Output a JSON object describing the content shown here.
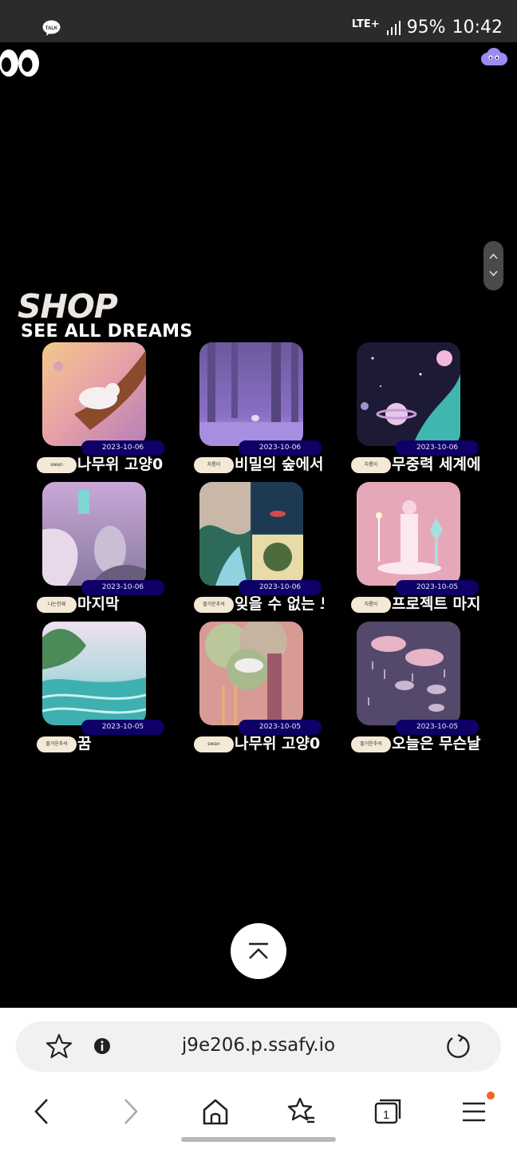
{
  "status_bar": {
    "talk_label": "TALK",
    "network": "LTE+",
    "battery": "95%",
    "time": "10:42",
    "icons": [
      "kakaotalk-icon",
      "signal-icon"
    ]
  },
  "header": {
    "logo": "eyes-logo-icon",
    "menu": "cloud-character-icon"
  },
  "shop": {
    "title": "SHOP",
    "subtitle": "SEE ALL DREAMS"
  },
  "cards": [
    {
      "date": "2023-10-06",
      "author": "swan",
      "title": "나무위 고양0"
    },
    {
      "date": "2023-10-06",
      "author": "차룡이",
      "title": "비밀의 숲에서"
    },
    {
      "date": "2023-10-06",
      "author": "차룡이",
      "title": "무중력 세계에서"
    },
    {
      "date": "2023-10-06",
      "author": "나는천재",
      "title": "마지막"
    },
    {
      "date": "2023-10-06",
      "author": "즐거운추석",
      "title": "잊을 수 없는 드"
    },
    {
      "date": "2023-10-05",
      "author": "차룡이",
      "title": "프로젝트 마지막"
    },
    {
      "date": "2023-10-05",
      "author": "즐거운추석",
      "title": "꿈"
    },
    {
      "date": "2023-10-05",
      "author": "swan",
      "title": "나무위 고양0"
    },
    {
      "date": "2023-10-05",
      "author": "즐거운추석",
      "title": "오늘은 무슨날"
    }
  ],
  "browser": {
    "url": "j9e206.p.ssafy.io",
    "icons": [
      "bookmark-star-icon",
      "site-info-icon",
      "reload-icon",
      "back-icon",
      "forward-icon",
      "home-icon",
      "bookmarks-icon",
      "tabs-icon",
      "menu-icon"
    ],
    "tab_count": "1"
  },
  "colors": {
    "background": "#000000",
    "date_badge": "#0e0066",
    "author_chip": "#f3e9d6",
    "shop_title": "#ece7e2"
  }
}
